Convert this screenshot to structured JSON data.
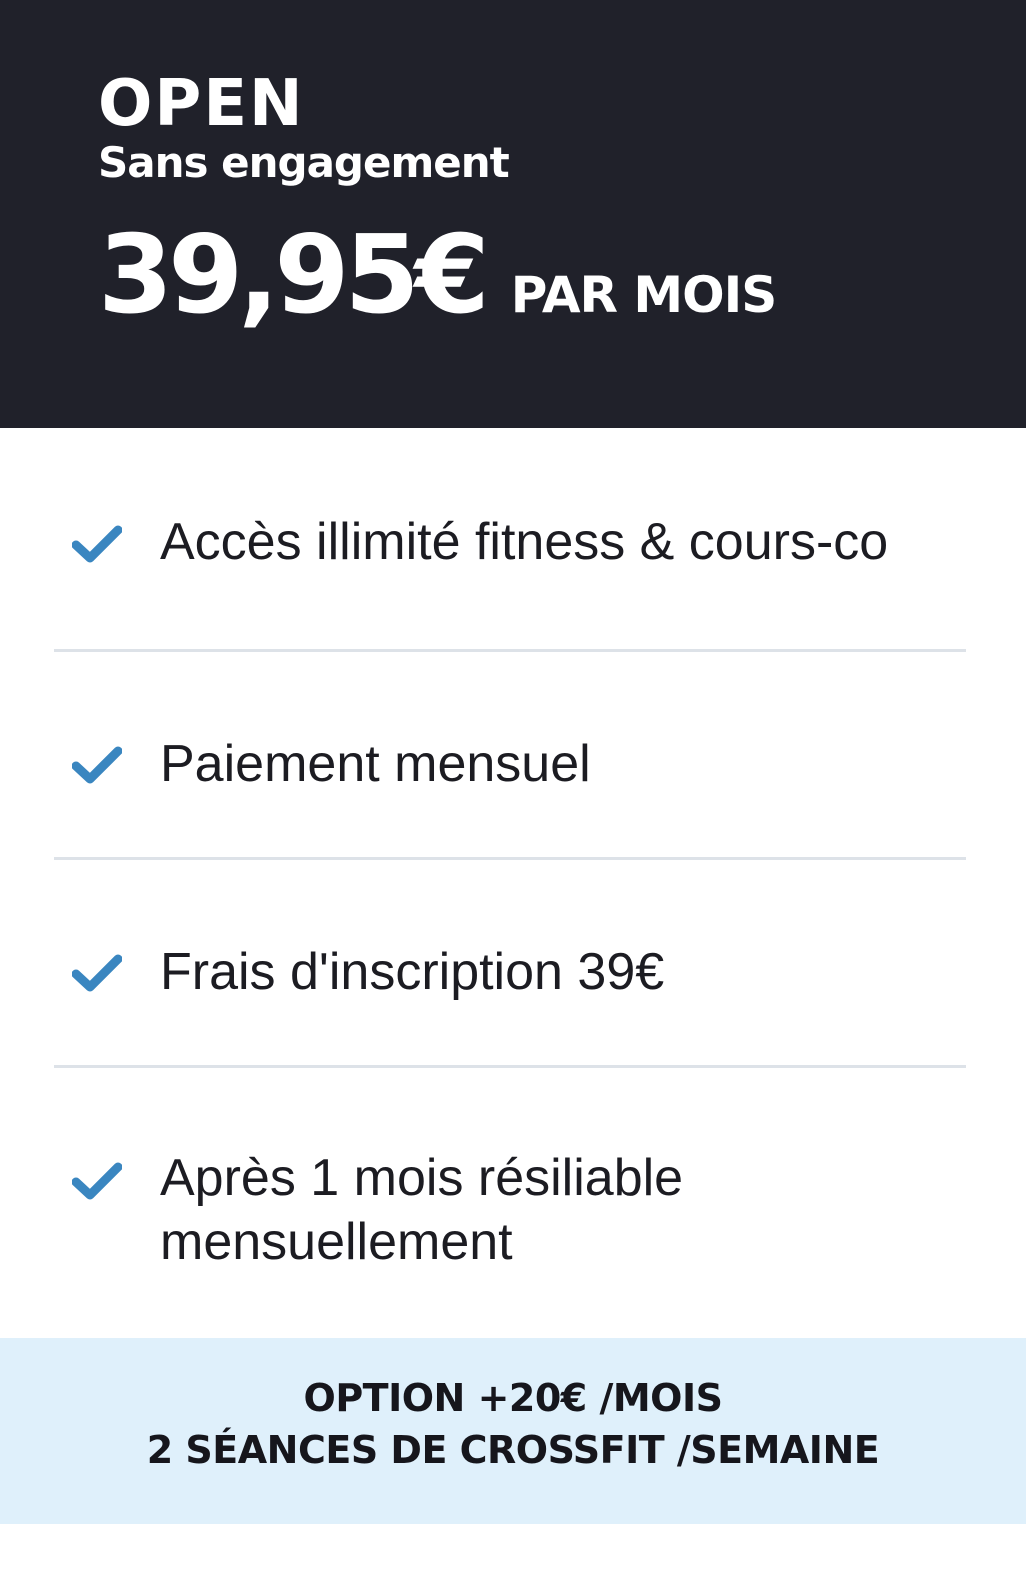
{
  "plan": {
    "name": "OPEN",
    "subtitle": "Sans engagement",
    "price": "39,95€",
    "period": "PAR MOIS"
  },
  "features": [
    {
      "icon": "check-icon",
      "text": "Accès illimité fitness & cours-co"
    },
    {
      "icon": "check-icon",
      "text": "Paiement mensuel"
    },
    {
      "icon": "check-icon",
      "text": "Frais d'inscription 39€"
    },
    {
      "icon": "check-icon",
      "text": "Après 1 mois résiliable mensuellement"
    }
  ],
  "option": {
    "line1": "OPTION +20€ /MOIS",
    "line2": "2 SÉANCES DE CROSSFIT /SEMAINE"
  },
  "colors": {
    "header_bg": "#20212a",
    "check": "#3a86c0",
    "option_bg": "#dff0fb",
    "divider": "#dde2e8"
  }
}
